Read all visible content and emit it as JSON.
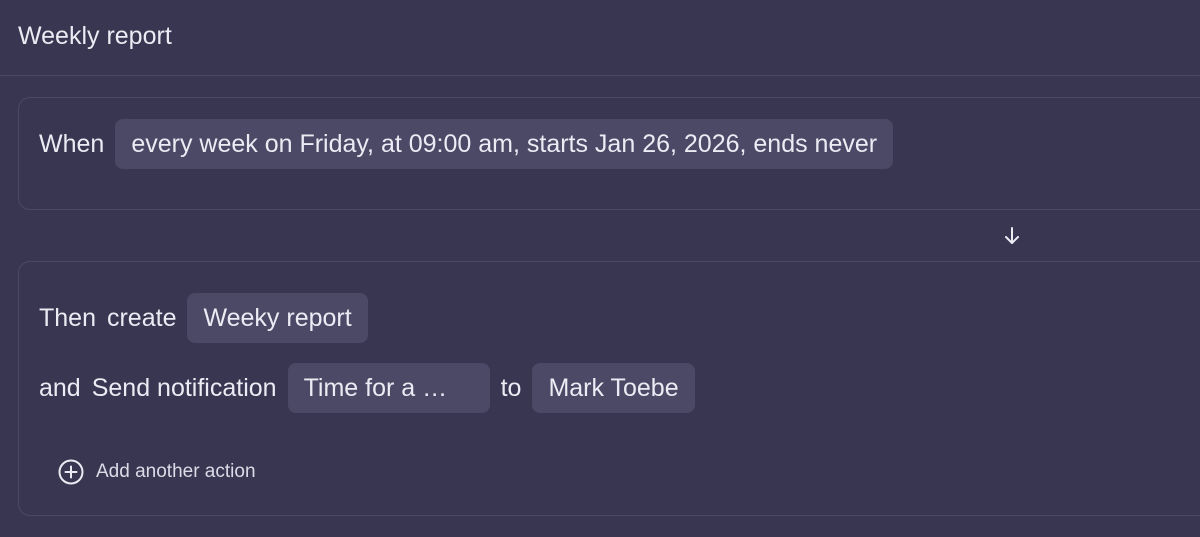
{
  "header": {
    "title": "Weekly report"
  },
  "trigger": {
    "when_label": "When",
    "schedule": "every week on Friday, at 09:00 am, starts Jan 26, 2026, ends never"
  },
  "flow_arrow": {
    "icon": "arrow-down-icon"
  },
  "actions": {
    "first": {
      "prefix": "Then",
      "verb": "create",
      "value": "Weeky report"
    },
    "second": {
      "prefix": "and",
      "verb": "Send notification",
      "message": "Time for a …",
      "connector": "to",
      "recipient": "Mark Toebe"
    },
    "add_label": "Add another action",
    "add_icon": "plus-circle-icon"
  },
  "colors": {
    "background": "#383650",
    "chip": "#4b4966",
    "text": "#ecebf4",
    "border": "#4b4965"
  }
}
